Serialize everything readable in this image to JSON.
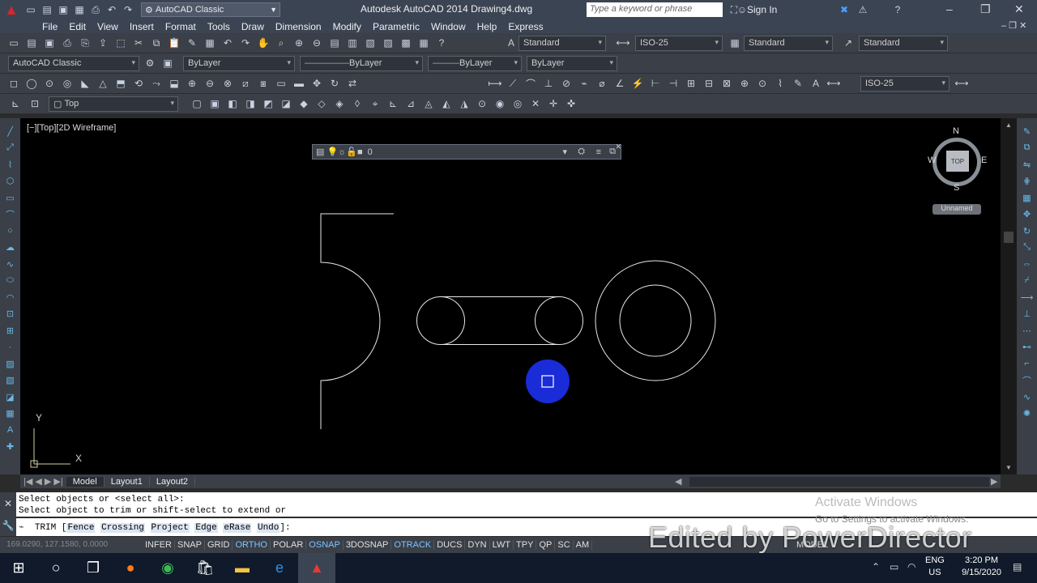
{
  "titlebar": {
    "workspace": "AutoCAD Classic",
    "title": "Autodesk AutoCAD 2014    Drawing4.dwg",
    "search_placeholder": "Type a keyword or phrase",
    "sign_in": "Sign In"
  },
  "menu": [
    "File",
    "Edit",
    "View",
    "Insert",
    "Format",
    "Tools",
    "Draw",
    "Dimension",
    "Modify",
    "Parametric",
    "Window",
    "Help",
    "Express"
  ],
  "styles": {
    "text_style": "Standard",
    "dim_style": "ISO-25",
    "table_style": "Standard",
    "mleader_style": "Standard"
  },
  "properties": {
    "workspace": "AutoCAD Classic",
    "color": "ByLayer",
    "linetype": "ByLayer",
    "lineweight": "ByLayer",
    "plotstyle": "ByLayer"
  },
  "dim_style_2": "ISO-25",
  "view_name": "Top",
  "viewport_label": "[−][Top][2D Wireframe]",
  "layer_current": "0",
  "viewcube": {
    "n": "N",
    "s": "S",
    "e": "E",
    "w": "W",
    "face": "TOP",
    "ucs": "Unnamed"
  },
  "ucs": {
    "x": "X",
    "y": "Y"
  },
  "layout_tabs": [
    "Model",
    "Layout1",
    "Layout2"
  ],
  "command": {
    "history_1": "Select objects or <select all>:",
    "history_2": "Select object to trim or shift-select to extend or",
    "name": "TRIM",
    "options": [
      "Fence",
      "Crossing",
      "Project",
      "Edge",
      "eRase",
      "Undo"
    ],
    "suffix": "]:"
  },
  "status": {
    "coords": "169.0290, 127.1580, 0.0000",
    "toggles": [
      {
        "label": "INFER",
        "on": false
      },
      {
        "label": "SNAP",
        "on": false
      },
      {
        "label": "GRID",
        "on": false
      },
      {
        "label": "ORTHO",
        "on": true
      },
      {
        "label": "POLAR",
        "on": false
      },
      {
        "label": "OSNAP",
        "on": true
      },
      {
        "label": "3DOSNAP",
        "on": false
      },
      {
        "label": "OTRACK",
        "on": true
      },
      {
        "label": "DUCS",
        "on": false
      },
      {
        "label": "DYN",
        "on": false
      },
      {
        "label": "LWT",
        "on": false
      },
      {
        "label": "TPY",
        "on": false
      },
      {
        "label": "QP",
        "on": false
      },
      {
        "label": "SC",
        "on": false
      },
      {
        "label": "AM",
        "on": false
      }
    ],
    "model": "MODEL"
  },
  "activate": {
    "line1": "Activate Windows",
    "line2": "Go to Settings to activate Windows."
  },
  "watermark": "Edited by PowerDirector",
  "taskbar": {
    "lang1": "ENG",
    "lang2": "US",
    "time": "3:20 PM",
    "date": "9/15/2020"
  }
}
